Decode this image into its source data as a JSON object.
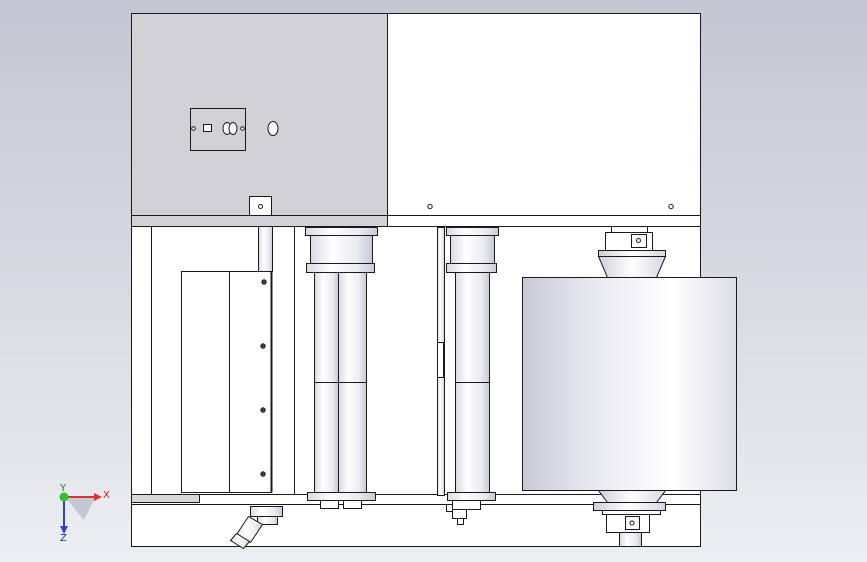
{
  "viewport": {
    "background_top": "#c3c7d3",
    "background_bottom": "#eceef2"
  },
  "model": {
    "panel_fill": "#ffffff",
    "shaded_panel_fill": "#d2d2d6",
    "edge_color": "#1a1a1a"
  },
  "triad": {
    "x_label": "X",
    "y_label": "Y",
    "z_label": "Z",
    "x_color": "#e03030",
    "y_color": "#30c030",
    "z_color": "#3040d0"
  }
}
